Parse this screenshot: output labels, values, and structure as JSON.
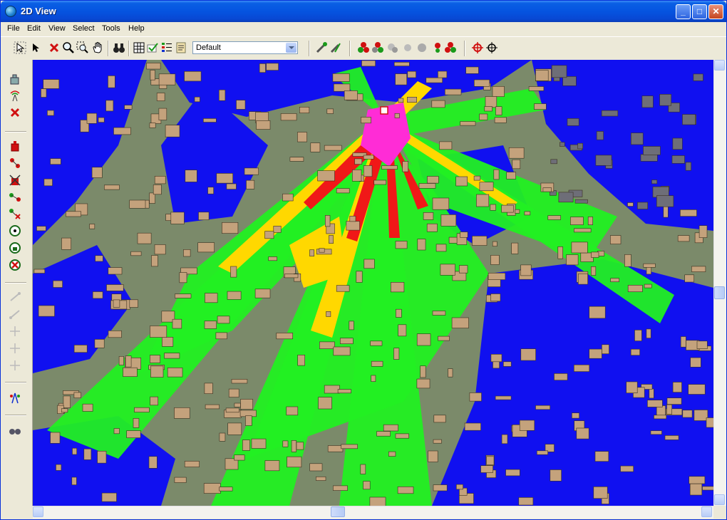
{
  "window": {
    "title": "2D View"
  },
  "menu": [
    "File",
    "Edit",
    "View",
    "Select",
    "Tools",
    "Help"
  ],
  "toolbar": {
    "layer_select": "Default"
  },
  "colors": {
    "terrain": "#7b8a6a",
    "buildings": "#c4a27c",
    "coverage_low": "#1010f0",
    "coverage_medium": "#22f022",
    "coverage_high": "#ffd800",
    "coverage_very_high": "#f01818",
    "coverage_max": "#ff2cd6"
  },
  "icons": {
    "top": [
      "pointer-select-icon",
      "arrow-select-icon",
      "delete-icon",
      "zoom-icon",
      "zoom-window-icon",
      "pan-hand-icon",
      "binoculars-icon",
      "grid-icon",
      "check-layer-icon",
      "list-icon",
      "properties-icon",
      "add-transmitter-icon",
      "edit-transmitter-icon",
      "site-icon",
      "group-site-icon",
      "gray-site-icon",
      "gray-site2-icon",
      "gray-site3-icon",
      "numbered-site-icon",
      "red-site-icon",
      "target-icon",
      "crosshair-icon"
    ],
    "left": [
      "building-icon",
      "antenna-icon",
      "red-x-icon",
      "red-building-icon",
      "red-link-icon",
      "delete-link-icon",
      "path-icon",
      "path-delete-icon",
      "circle-target-icon",
      "green-lock-icon",
      "red-x-circle-icon",
      "gray-link-icon",
      "gray-link2-icon",
      "gray-cross-icon",
      "gray-cross2-icon",
      "gray-cross3-icon",
      "tower-icon",
      "binoculars-icon"
    ]
  }
}
